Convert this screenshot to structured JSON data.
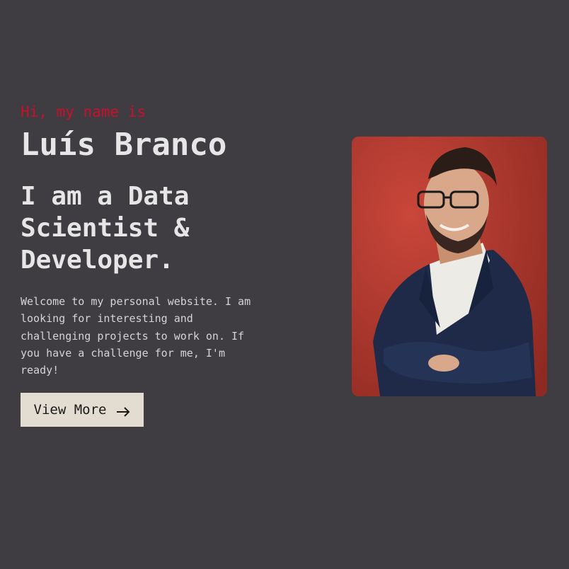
{
  "hero": {
    "greeting": "Hi, my name is",
    "name": "Luís Branco",
    "role": "I am a Data Scientist & Developer.",
    "intro": "Welcome to my personal website. I am looking for interesting and challenging projects to work on. If you have a challenge for me, I'm ready!",
    "cta_label": "View More",
    "cta_icon": "arrow-right-icon"
  },
  "colors": {
    "background": "#403d42",
    "accent": "#c8102e",
    "heading": "#e6e6e6",
    "button_bg": "#e3ddd1"
  }
}
